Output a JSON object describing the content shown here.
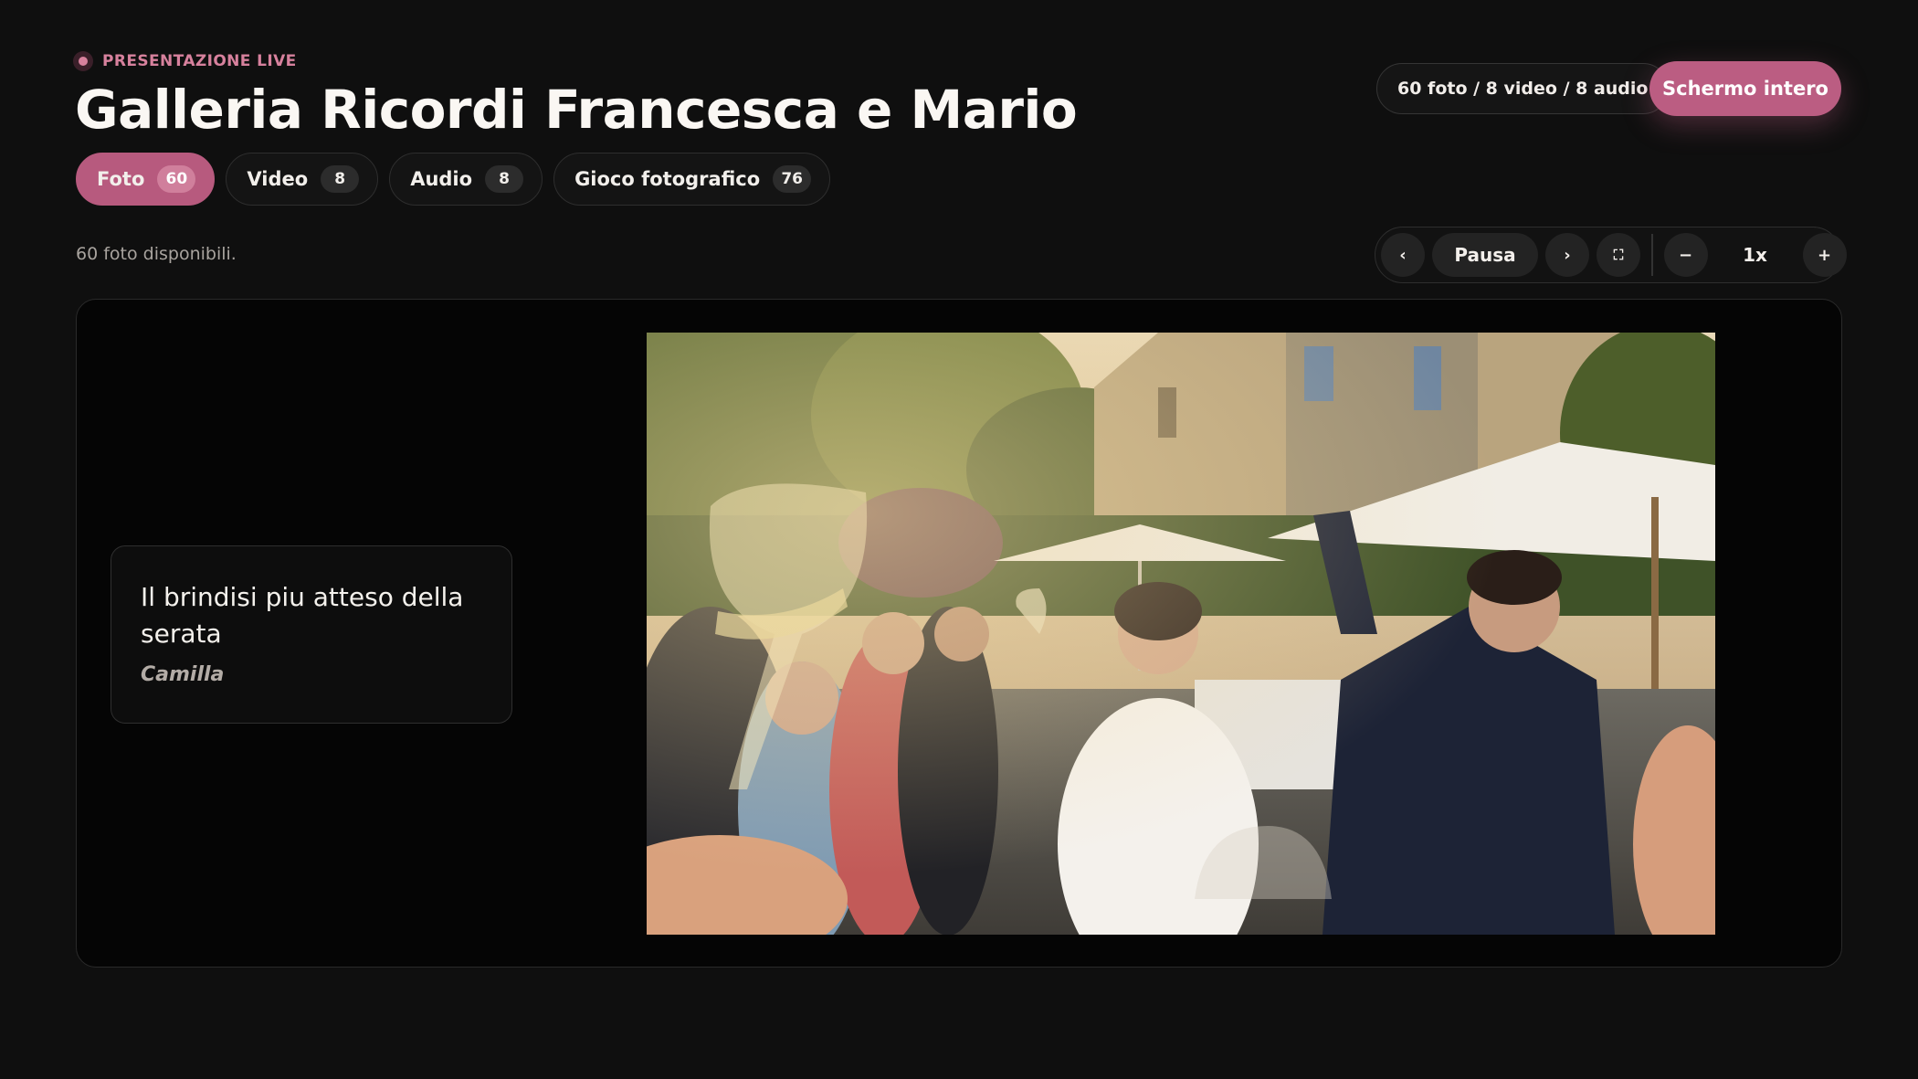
{
  "header": {
    "live_label": "PRESENTAZIONE LIVE",
    "title": "Galleria Ricordi Francesca e Mario",
    "media_summary": "60 foto / 8 video / 8 audio",
    "fullscreen_label": "Schermo intero"
  },
  "tabs": [
    {
      "label": "Foto",
      "count": "60",
      "active": true
    },
    {
      "label": "Video",
      "count": "8",
      "active": false
    },
    {
      "label": "Audio",
      "count": "8",
      "active": false
    },
    {
      "label": "Gioco fotografico",
      "count": "76",
      "active": false
    }
  ],
  "status": {
    "available": "60 foto disponibili."
  },
  "controls": {
    "prev_icon": "chevron-left-icon",
    "prev_glyph": "‹",
    "pause_label": "Pausa",
    "next_icon": "chevron-right-icon",
    "next_glyph": "›",
    "expand_icon": "expand-icon",
    "expand_glyph": "⛶",
    "zoom_out_glyph": "−",
    "speed": "1x",
    "zoom_in_glyph": "+"
  },
  "slide": {
    "caption": "Il brindisi piu atteso della serata",
    "author": "Camilla"
  },
  "colors": {
    "accent": "#bb5d82",
    "accent_soft": "#d7819d",
    "background": "#0f0f0f"
  }
}
